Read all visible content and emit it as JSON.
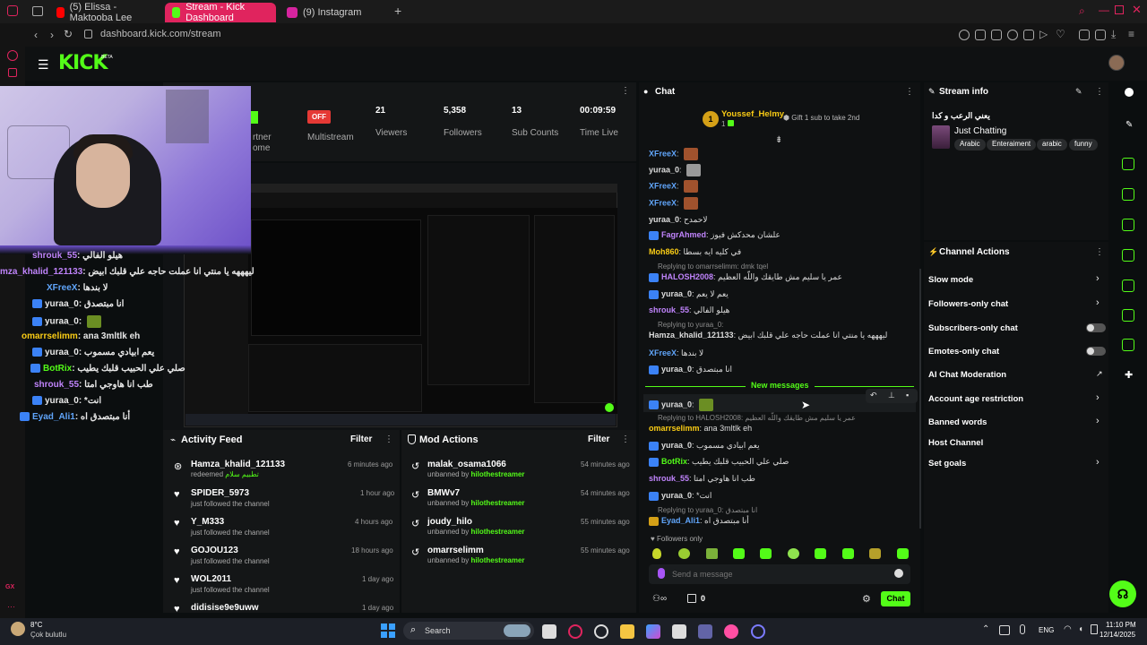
{
  "browser": {
    "tabs": [
      {
        "label": "(5) Elissa - Maktooba Lee",
        "color": "#ff0000"
      },
      {
        "label": "Stream - Kick Dashboard",
        "color": "#53fc18"
      },
      {
        "label": "(9) Instagram",
        "color": "#d6249f"
      }
    ],
    "url": "dashboard.kick.com/stream"
  },
  "kick": {
    "logo": "KICK",
    "beta": "BETA"
  },
  "stats": [
    {
      "value": "",
      "label": "rtner\nome"
    },
    {
      "value": "OFF",
      "label": "Multistream"
    },
    {
      "value": "21",
      "label": "Viewers"
    },
    {
      "value": "5,358",
      "label": "Followers"
    },
    {
      "value": "13",
      "label": "Sub Counts"
    },
    {
      "value": "00:09:59",
      "label": "Time Live"
    }
  ],
  "overlay_chat": [
    {
      "name": "shrouk_55",
      "text": "هيلو الفالي",
      "color": "#c084fc"
    },
    {
      "name": "mza_khalid_121133",
      "text": "ليهههه يا منتي انا عملت حاجه علي قلبك ابيض",
      "color": "#c084fc"
    },
    {
      "name": "XFreeX",
      "text": "لا بندها",
      "color": "#60a5fa"
    },
    {
      "name": "yuraa_0",
      "text": "انا مبتصدق",
      "color": "#e5e5e5"
    },
    {
      "name": "yuraa_0",
      "text": "",
      "color": "#e5e5e5"
    },
    {
      "name": "omarrselimm",
      "text": "ana 3mltlk eh",
      "color": "#facc15"
    },
    {
      "name": "yuraa_0",
      "text": "يعم ابيادي مسموب",
      "color": "#e5e5e5"
    },
    {
      "name": "BotRix",
      "text": "صلي علي الحبيب قلبك يطيب",
      "color": "#53fc18"
    },
    {
      "name": "shrouk_55",
      "text": "طب انا هاوجي امتا",
      "color": "#c084fc"
    },
    {
      "name": "yuraa_0",
      "text": "*انت",
      "color": "#e5e5e5"
    },
    {
      "name": "Eyad_Ali1",
      "text": "أنا مبتصدق اه",
      "color": "#60a5fa"
    }
  ],
  "activity": {
    "title": "Activity Feed",
    "filter": "Filter",
    "items": [
      {
        "name": "Hamza_khalid_121133",
        "sub": "redeemed",
        "sub_green": "تطبيم سلام",
        "time": "6 minutes ago"
      },
      {
        "name": "SPIDER_5973",
        "sub": "just followed the channel",
        "time": "1 hour ago"
      },
      {
        "name": "Y_M333",
        "sub": "just followed the channel",
        "time": "4 hours ago"
      },
      {
        "name": "GOJOU123",
        "sub": "just followed the channel",
        "time": "18 hours ago"
      },
      {
        "name": "WOL2011",
        "sub": "just followed the channel",
        "time": "1 day ago"
      },
      {
        "name": "didisise9e9uww",
        "sub": "",
        "time": "1 day ago"
      }
    ]
  },
  "mod": {
    "title": "Mod Actions",
    "filter": "Filter",
    "items": [
      {
        "name": "malak_osama1066",
        "sub": "unbanned by",
        "by": "hilothestreamer",
        "time": "54 minutes ago"
      },
      {
        "name": "BMWv7",
        "sub": "unbanned by",
        "by": "hilothestreamer",
        "time": "54 minutes ago"
      },
      {
        "name": "joudy_hilo",
        "sub": "unbanned by",
        "by": "hilothestreamer",
        "time": "55 minutes ago"
      },
      {
        "name": "omarrselimm",
        "sub": "unbanned by",
        "by": "hilothestreamer",
        "time": "55 minutes ago"
      }
    ]
  },
  "chat": {
    "title": "Chat",
    "top_gifter": "Youssef_Helmy",
    "gifter_rank": "1",
    "gifter_count": "1",
    "gift_hint": "Gift 1 sub to take 2nd",
    "messages": [
      {
        "name": "XFreeX",
        "text": "",
        "color": "#60a5fa"
      },
      {
        "name": "yuraa_0",
        "text": "",
        "color": "#e5e5e5"
      },
      {
        "name": "XFreeX",
        "text": "",
        "color": "#60a5fa"
      },
      {
        "name": "XFreeX",
        "text": "",
        "color": "#60a5fa"
      },
      {
        "name": "yuraa_0",
        "text": "لاحمدح",
        "color": "#e5e5e5"
      },
      {
        "name": "FagrAhmed",
        "text": "علشان محدكش فيوز",
        "color": "#c084fc"
      },
      {
        "name": "Moh860",
        "text": "في كليه ايه بسطا",
        "color": "#facc15"
      },
      {
        "name": "HALOSH2008",
        "text": "عمر يا سليم مش طايقك واللّه العظيم",
        "color": "#c084fc"
      },
      {
        "name": "yuraa_0",
        "text": "يعم لا يعم",
        "color": "#e5e5e5"
      },
      {
        "name": "shrouk_55",
        "text": "هيلو الفالي",
        "color": "#c084fc"
      },
      {
        "name": "Hamza_khalid_121133",
        "text": "ليهههه يا منتي انا عملت حاجه علي قلبك ابيض",
        "color": "#e5e5e5"
      },
      {
        "name": "XFreeX",
        "text": "لا بندها",
        "color": "#60a5fa"
      },
      {
        "name": "yuraa_0",
        "text": "انا مبتصدق",
        "color": "#e5e5e5"
      }
    ],
    "replies": [
      "Replying to omarrselimm: dmk tqel",
      "Replying to yuraa_0: ",
      "Replying to HALOSH2008: عمر يا سليم مش طايقك واللّه العظيم",
      "Replying to yuraa_0: انا مبتصدق"
    ],
    "new_messages": "New messages",
    "messages2": [
      {
        "name": "yuraa_0",
        "text": "",
        "color": "#e5e5e5"
      },
      {
        "name": "omarrselimm",
        "text": "ana 3mltlk eh",
        "color": "#facc15"
      },
      {
        "name": "yuraa_0",
        "text": "يعم ابيادي مسموب",
        "color": "#e5e5e5"
      },
      {
        "name": "BotRix",
        "text": "صلي علي الحبيب قلبك يطيب",
        "color": "#53fc18"
      },
      {
        "name": "shrouk_55",
        "text": "طب انا هاوجي امتا",
        "color": "#c084fc"
      },
      {
        "name": "yuraa_0",
        "text": "*انت",
        "color": "#e5e5e5"
      },
      {
        "name": "Eyad_Ali1",
        "text": "أنا مبتصدق اه",
        "color": "#60a5fa"
      }
    ],
    "followers_only": "Followers only",
    "placeholder": "Send a message",
    "points": "0",
    "send_label": "Chat"
  },
  "stream_info": {
    "title": "Stream info",
    "stream_title": "يعني الرعب و كدا",
    "category": "Just Chatting",
    "tags": [
      "Arabic",
      "Enteraiment",
      "arabic",
      "funny"
    ]
  },
  "channel_actions": {
    "title": "Channel Actions",
    "items": [
      {
        "label": "Slow mode",
        "kind": "chevron"
      },
      {
        "label": "Followers-only chat",
        "kind": "chevron"
      },
      {
        "label": "Subscribers-only chat",
        "kind": "toggle"
      },
      {
        "label": "Emotes-only chat",
        "kind": "toggle"
      },
      {
        "label": "AI Chat Moderation",
        "kind": "external"
      },
      {
        "label": "Account age restriction",
        "kind": "chevron"
      },
      {
        "label": "Banned words",
        "kind": "chevron"
      },
      {
        "label": "Host Channel",
        "kind": "none"
      },
      {
        "label": "Set goals",
        "kind": "chevron"
      }
    ]
  },
  "taskbar": {
    "weather_temp": "8°C",
    "weather_desc": "Çok bulutlu",
    "search": "Search",
    "lang": "ENG",
    "time": "11:10 PM",
    "date": "12/14/2025"
  }
}
